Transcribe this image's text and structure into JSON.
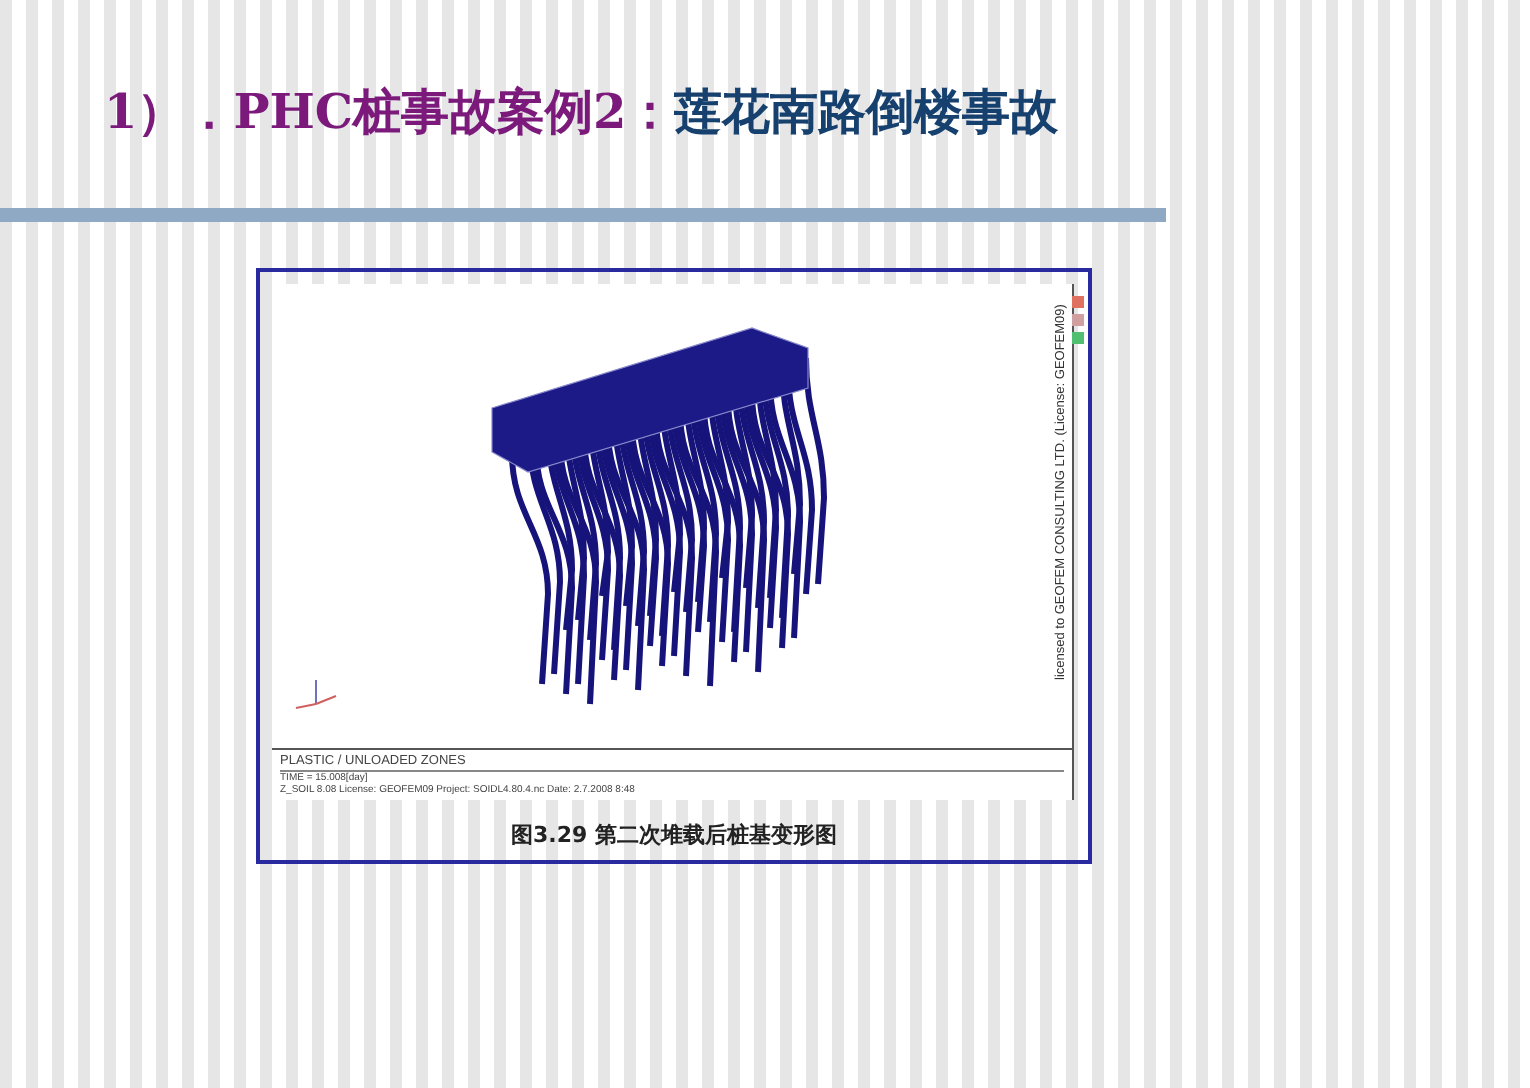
{
  "title": {
    "segments": [
      {
        "text": "1）．PHC桩事故案例2：",
        "color": "#7b1a7b"
      },
      {
        "text": "莲花南路倒楼事故",
        "color": "#16406e"
      }
    ]
  },
  "figure": {
    "screenshot": {
      "legend_title": "PLASTIC / UNLOADED ZONES",
      "time": "TIME = 15.008[day]",
      "footer": "Z_SOIL 8.08  License: GEOFEM09  Project: SOIDL4.80.4.nc  Date: 2.7.2008  8:48",
      "license_note": "licensed to GEOFEM CONSULTING LTD. (License: GEOFEM09)"
    },
    "caption": "图3.29  第二次堆载后桩基变形图"
  }
}
